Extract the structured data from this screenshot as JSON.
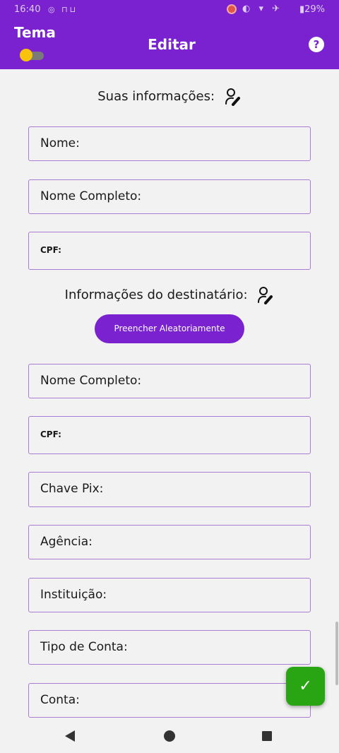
{
  "status_bar": {
    "time": "16:40",
    "left_icons": "◎ ⊓⊔",
    "right_icons": "◐ ▾ ✈",
    "battery": "▮29%"
  },
  "header": {
    "theme_label": "Tema",
    "theme_toggle_on": true,
    "title": "Editar",
    "help_icon": "?"
  },
  "your_info": {
    "heading": "Suas informações:",
    "fields": {
      "nome": "Nome:",
      "nome_completo": "Nome Completo:",
      "cpf": "CPF:"
    }
  },
  "recipient": {
    "heading": "Informações do destinatário:",
    "random_button": "Preencher Aleatoriamente",
    "fields": {
      "nome_completo": "Nome Completo:",
      "cpf": "CPF:",
      "chave_pix": "Chave Pix:",
      "agencia": "Agência:",
      "instituicao": "Instituição:",
      "tipo_conta": "Tipo de Conta:",
      "conta": "Conta:"
    }
  },
  "fab": {
    "icon": "check-icon",
    "glyph": "✓"
  },
  "colors": {
    "primary": "#7b22d0",
    "accent_toggle": "#f7c40b",
    "confirm": "#29a514",
    "field_border": "#a97cd6"
  }
}
